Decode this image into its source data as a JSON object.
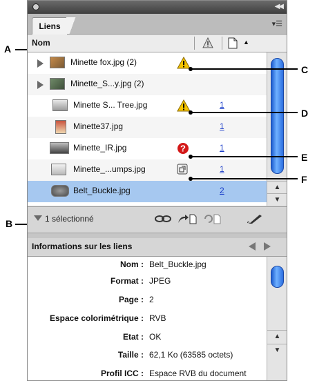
{
  "panel": {
    "tab_label": "Liens",
    "panel_menu_icon": "panel-menu-icon",
    "column_name": "Nom",
    "column_status_icon": "warning-icon",
    "column_page_icon": "page-icon",
    "sort_icon": "sort-arrow-icon"
  },
  "links": [
    {
      "name": "Minette fox.jpg (2)",
      "status": "warning",
      "page": "",
      "expandable": true,
      "selected": false
    },
    {
      "name": "Minette_S...y.jpg (2)",
      "status": "",
      "page": "",
      "expandable": true,
      "selected": false
    },
    {
      "name": "Minette S... Tree.jpg",
      "status": "warning",
      "page": "1",
      "expandable": false,
      "selected": false
    },
    {
      "name": "Minette37.jpg",
      "status": "",
      "page": "1",
      "expandable": false,
      "selected": false
    },
    {
      "name": "Minette_IR.jpg",
      "status": "missing",
      "page": "1",
      "expandable": false,
      "selected": false
    },
    {
      "name": "Minette_...umps.jpg",
      "status": "embedded",
      "page": "1",
      "expandable": false,
      "selected": false
    },
    {
      "name": "Belt_Buckle.jpg",
      "status": "",
      "page": "2",
      "expandable": false,
      "selected": true
    }
  ],
  "toolbar": {
    "selection_count": "1 sélectionné",
    "tools": [
      "relink-icon",
      "goto-link-icon",
      "update-link-icon",
      "edit-original-icon"
    ]
  },
  "info": {
    "title": "Informations sur les liens",
    "rows": [
      {
        "label": "Nom :",
        "value": "Belt_Buckle.jpg"
      },
      {
        "label": "Format :",
        "value": "JPEG"
      },
      {
        "label": "Page :",
        "value": "2"
      },
      {
        "label": "Espace colorimétrique :",
        "value": "RVB"
      },
      {
        "label": "Etat :",
        "value": "OK"
      },
      {
        "label": "Taille :",
        "value": "62,1 Ko (63585 octets)"
      },
      {
        "label": "Profil ICC :",
        "value": "Espace RVB du document"
      }
    ]
  },
  "callouts": {
    "a": "A",
    "b": "B",
    "c": "C",
    "d": "D",
    "e": "E",
    "f": "F"
  },
  "colors": {
    "selection": "#a6c8f0",
    "scroll_thumb": "#2c6fe0",
    "link_blue": "#1b3ec9"
  }
}
